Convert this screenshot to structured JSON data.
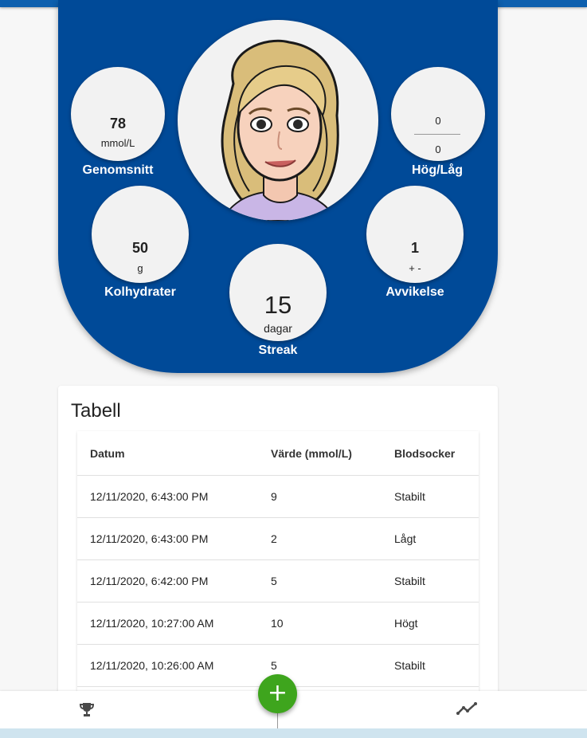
{
  "stats": {
    "average": {
      "value": "78",
      "unit": "mmol/L",
      "label": "Genomsnitt"
    },
    "high_low": {
      "high": "0",
      "low": "0",
      "label": "Hög/Låg"
    },
    "carbs": {
      "value": "50",
      "unit": "g",
      "label": "Kolhydrater"
    },
    "deviation": {
      "value": "1",
      "unit": "+ -",
      "label": "Avvikelse"
    },
    "streak": {
      "value": "15",
      "unit": "dagar",
      "label": "Streak"
    }
  },
  "table": {
    "title": "Tabell",
    "headers": [
      "Datum",
      "Värde (mmol/L)",
      "Blodsocker"
    ],
    "rows": [
      [
        "12/11/2020, 6:43:00 PM",
        "9",
        "Stabilt"
      ],
      [
        "12/11/2020, 6:43:00 PM",
        "2",
        "Lågt"
      ],
      [
        "12/11/2020, 6:42:00 PM",
        "5",
        "Stabilt"
      ],
      [
        "12/11/2020, 10:27:00 AM",
        "10",
        "Högt"
      ],
      [
        "12/11/2020, 10:26:00 AM",
        "5",
        "Stabilt"
      ],
      [
        "",
        "",
        ""
      ]
    ]
  },
  "bottom_nav": {
    "left_icon": "trophy-icon",
    "center_icon": "plus-icon",
    "center_label": "+",
    "right_icon": "trend-line-icon"
  },
  "colors": {
    "hero_blue": "#004a98",
    "topbar_blue": "#0d5fae",
    "fab_green": "#3ea51d"
  }
}
